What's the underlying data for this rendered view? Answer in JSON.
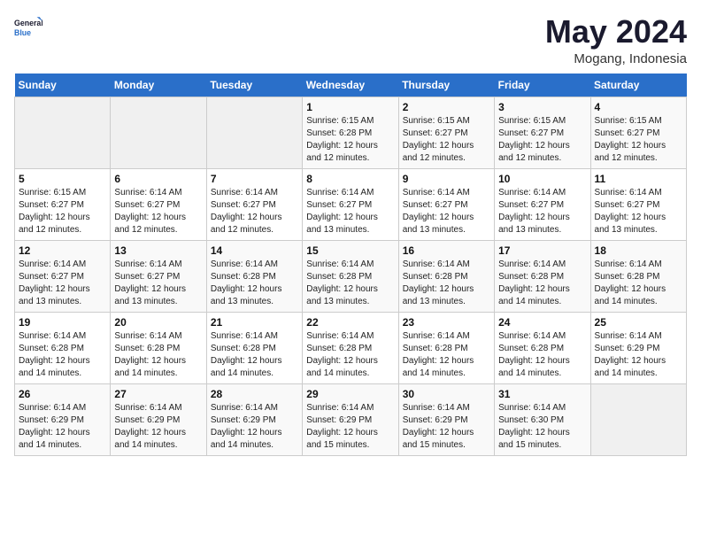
{
  "header": {
    "logo_line1": "General",
    "logo_line2": "Blue",
    "title": "May 2024",
    "subtitle": "Mogang, Indonesia"
  },
  "weekdays": [
    "Sunday",
    "Monday",
    "Tuesday",
    "Wednesday",
    "Thursday",
    "Friday",
    "Saturday"
  ],
  "weeks": [
    [
      {
        "day": "",
        "info": ""
      },
      {
        "day": "",
        "info": ""
      },
      {
        "day": "",
        "info": ""
      },
      {
        "day": "1",
        "info": "Sunrise: 6:15 AM\nSunset: 6:28 PM\nDaylight: 12 hours\nand 12 minutes."
      },
      {
        "day": "2",
        "info": "Sunrise: 6:15 AM\nSunset: 6:27 PM\nDaylight: 12 hours\nand 12 minutes."
      },
      {
        "day": "3",
        "info": "Sunrise: 6:15 AM\nSunset: 6:27 PM\nDaylight: 12 hours\nand 12 minutes."
      },
      {
        "day": "4",
        "info": "Sunrise: 6:15 AM\nSunset: 6:27 PM\nDaylight: 12 hours\nand 12 minutes."
      }
    ],
    [
      {
        "day": "5",
        "info": "Sunrise: 6:15 AM\nSunset: 6:27 PM\nDaylight: 12 hours\nand 12 minutes."
      },
      {
        "day": "6",
        "info": "Sunrise: 6:14 AM\nSunset: 6:27 PM\nDaylight: 12 hours\nand 12 minutes."
      },
      {
        "day": "7",
        "info": "Sunrise: 6:14 AM\nSunset: 6:27 PM\nDaylight: 12 hours\nand 12 minutes."
      },
      {
        "day": "8",
        "info": "Sunrise: 6:14 AM\nSunset: 6:27 PM\nDaylight: 12 hours\nand 13 minutes."
      },
      {
        "day": "9",
        "info": "Sunrise: 6:14 AM\nSunset: 6:27 PM\nDaylight: 12 hours\nand 13 minutes."
      },
      {
        "day": "10",
        "info": "Sunrise: 6:14 AM\nSunset: 6:27 PM\nDaylight: 12 hours\nand 13 minutes."
      },
      {
        "day": "11",
        "info": "Sunrise: 6:14 AM\nSunset: 6:27 PM\nDaylight: 12 hours\nand 13 minutes."
      }
    ],
    [
      {
        "day": "12",
        "info": "Sunrise: 6:14 AM\nSunset: 6:27 PM\nDaylight: 12 hours\nand 13 minutes."
      },
      {
        "day": "13",
        "info": "Sunrise: 6:14 AM\nSunset: 6:27 PM\nDaylight: 12 hours\nand 13 minutes."
      },
      {
        "day": "14",
        "info": "Sunrise: 6:14 AM\nSunset: 6:28 PM\nDaylight: 12 hours\nand 13 minutes."
      },
      {
        "day": "15",
        "info": "Sunrise: 6:14 AM\nSunset: 6:28 PM\nDaylight: 12 hours\nand 13 minutes."
      },
      {
        "day": "16",
        "info": "Sunrise: 6:14 AM\nSunset: 6:28 PM\nDaylight: 12 hours\nand 13 minutes."
      },
      {
        "day": "17",
        "info": "Sunrise: 6:14 AM\nSunset: 6:28 PM\nDaylight: 12 hours\nand 14 minutes."
      },
      {
        "day": "18",
        "info": "Sunrise: 6:14 AM\nSunset: 6:28 PM\nDaylight: 12 hours\nand 14 minutes."
      }
    ],
    [
      {
        "day": "19",
        "info": "Sunrise: 6:14 AM\nSunset: 6:28 PM\nDaylight: 12 hours\nand 14 minutes."
      },
      {
        "day": "20",
        "info": "Sunrise: 6:14 AM\nSunset: 6:28 PM\nDaylight: 12 hours\nand 14 minutes."
      },
      {
        "day": "21",
        "info": "Sunrise: 6:14 AM\nSunset: 6:28 PM\nDaylight: 12 hours\nand 14 minutes."
      },
      {
        "day": "22",
        "info": "Sunrise: 6:14 AM\nSunset: 6:28 PM\nDaylight: 12 hours\nand 14 minutes."
      },
      {
        "day": "23",
        "info": "Sunrise: 6:14 AM\nSunset: 6:28 PM\nDaylight: 12 hours\nand 14 minutes."
      },
      {
        "day": "24",
        "info": "Sunrise: 6:14 AM\nSunset: 6:28 PM\nDaylight: 12 hours\nand 14 minutes."
      },
      {
        "day": "25",
        "info": "Sunrise: 6:14 AM\nSunset: 6:29 PM\nDaylight: 12 hours\nand 14 minutes."
      }
    ],
    [
      {
        "day": "26",
        "info": "Sunrise: 6:14 AM\nSunset: 6:29 PM\nDaylight: 12 hours\nand 14 minutes."
      },
      {
        "day": "27",
        "info": "Sunrise: 6:14 AM\nSunset: 6:29 PM\nDaylight: 12 hours\nand 14 minutes."
      },
      {
        "day": "28",
        "info": "Sunrise: 6:14 AM\nSunset: 6:29 PM\nDaylight: 12 hours\nand 14 minutes."
      },
      {
        "day": "29",
        "info": "Sunrise: 6:14 AM\nSunset: 6:29 PM\nDaylight: 12 hours\nand 15 minutes."
      },
      {
        "day": "30",
        "info": "Sunrise: 6:14 AM\nSunset: 6:29 PM\nDaylight: 12 hours\nand 15 minutes."
      },
      {
        "day": "31",
        "info": "Sunrise: 6:14 AM\nSunset: 6:30 PM\nDaylight: 12 hours\nand 15 minutes."
      },
      {
        "day": "",
        "info": ""
      }
    ]
  ]
}
